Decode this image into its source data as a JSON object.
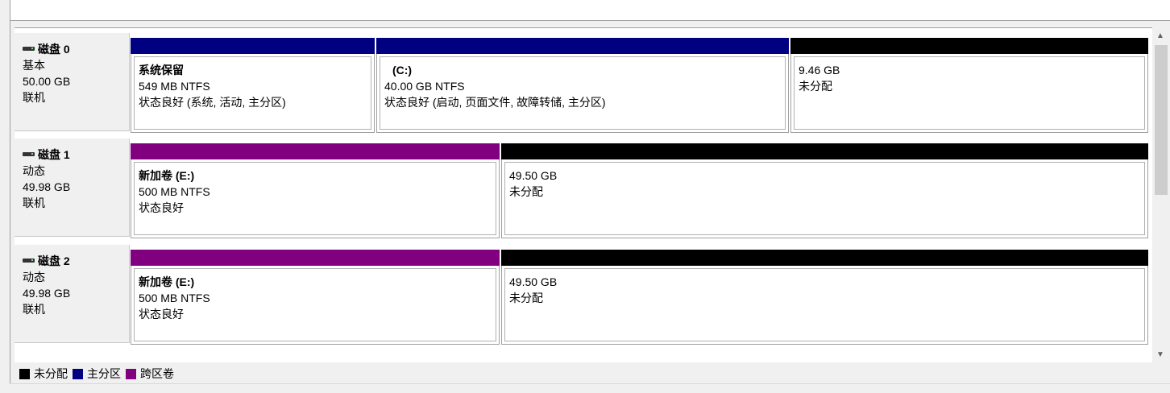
{
  "disks": [
    {
      "name": "磁盘 0",
      "type": "基本",
      "size": "50.00 GB",
      "status": "联机",
      "partitions": [
        {
          "kind": "primary",
          "title": "系统保留",
          "size": "549 MB NTFS",
          "status": "状态良好 (系统, 活动, 主分区)"
        },
        {
          "kind": "primary",
          "title": "(C:)",
          "size": "40.00 GB NTFS",
          "status": "状态良好 (启动, 页面文件, 故障转储, 主分区)"
        },
        {
          "kind": "unallocated",
          "title": "",
          "size": "9.46 GB",
          "status": "未分配"
        }
      ]
    },
    {
      "name": "磁盘 1",
      "type": "动态",
      "size": "49.98 GB",
      "status": "联机",
      "partitions": [
        {
          "kind": "spanned",
          "title": "新加卷 (E:)",
          "size": "500 MB NTFS",
          "status": "状态良好"
        },
        {
          "kind": "unallocated",
          "title": "",
          "size": "49.50 GB",
          "status": "未分配"
        }
      ]
    },
    {
      "name": "磁盘 2",
      "type": "动态",
      "size": "49.98 GB",
      "status": "联机",
      "partitions": [
        {
          "kind": "spanned",
          "title": "新加卷 (E:)",
          "size": "500 MB NTFS",
          "status": "状态良好"
        },
        {
          "kind": "unallocated",
          "title": "",
          "size": "49.50 GB",
          "status": "未分配"
        }
      ]
    }
  ],
  "legend": [
    {
      "label": "未分配",
      "color": "#000000"
    },
    {
      "label": "主分区",
      "color": "#000080"
    },
    {
      "label": "跨区卷",
      "color": "#800080"
    }
  ],
  "colors": {
    "primary": "#000080",
    "unallocated": "#000000",
    "spanned": "#800080"
  },
  "icons": {
    "disk": "disk-drive-icon",
    "scroll_up": "chevron-up-icon",
    "scroll_down": "chevron-down-icon"
  }
}
